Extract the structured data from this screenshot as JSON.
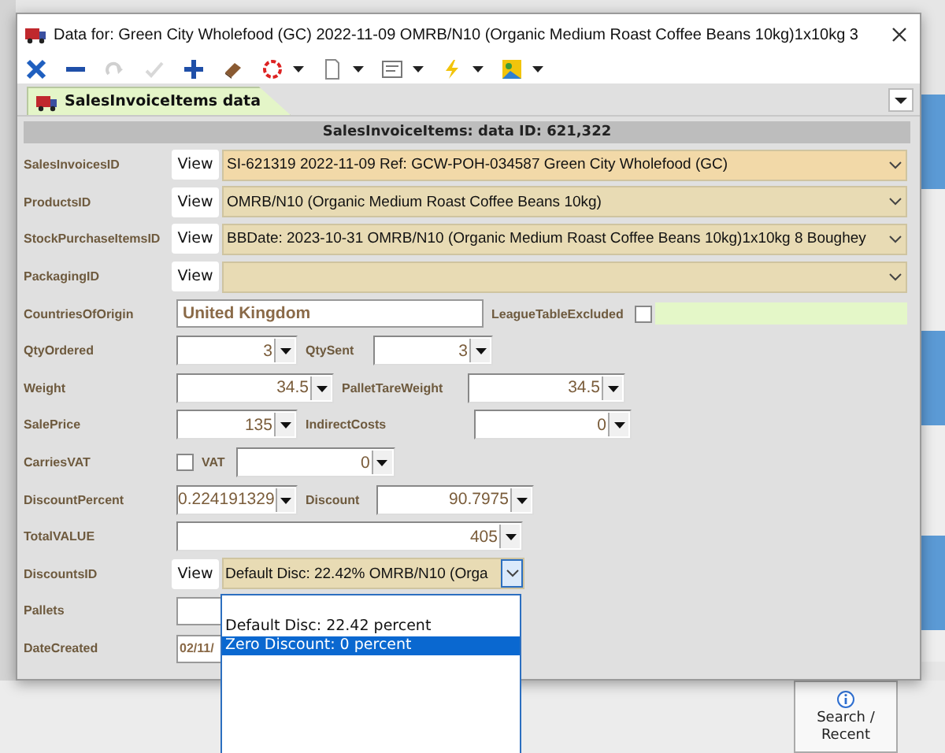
{
  "window": {
    "title": "Data for: Green City Wholefood (GC) 2022-11-09 OMRB/N10 (Organic Medium Roast Coffee Beans 10kg)1x10kg 3"
  },
  "toolbar": [
    {
      "kind": "cancel",
      "disabled": false,
      "menu": false
    },
    {
      "kind": "remove",
      "disabled": false,
      "menu": false
    },
    {
      "kind": "redo",
      "disabled": true,
      "menu": false
    },
    {
      "kind": "confirm",
      "disabled": true,
      "menu": false
    },
    {
      "kind": "add",
      "disabled": false,
      "menu": false
    },
    {
      "kind": "eraser",
      "disabled": false,
      "menu": false
    },
    {
      "kind": "undo",
      "disabled": false,
      "menu": true
    },
    {
      "kind": "document",
      "disabled": false,
      "menu": true
    },
    {
      "kind": "form",
      "disabled": false,
      "menu": true
    },
    {
      "kind": "lightning",
      "disabled": false,
      "menu": true
    },
    {
      "kind": "picture",
      "disabled": false,
      "menu": true
    }
  ],
  "tabs": [
    {
      "label": "SalesInvoiceItems data",
      "selected": true
    }
  ],
  "panel": {
    "header": "SalesInvoiceItems: data ID: 621,322",
    "rows": [
      {
        "items": [
          {
            "kind": "label",
            "text": "SalesInvoicesID"
          },
          {
            "kind": "view",
            "text": "View"
          },
          {
            "kind": "combo",
            "value": "SI-621319 2022-11-09 Ref: GCW-POH-034587 Green City Wholefood (GC)",
            "open": false
          }
        ]
      },
      {
        "items": [
          {
            "kind": "label",
            "text": "ProductsID"
          },
          {
            "kind": "view",
            "text": "View"
          },
          {
            "kind": "combo",
            "value": "OMRB/N10 (Organic Medium Roast Coffee Beans 10kg)",
            "open": false
          }
        ]
      },
      {
        "items": [
          {
            "kind": "label",
            "text": "StockPurchaseItemsID"
          },
          {
            "kind": "view",
            "text": "View"
          },
          {
            "kind": "combo",
            "value": "BBDate: 2023-10-31 OMRB/N10 (Organic Medium Roast Coffee Beans 10kg)1x10kg 8 Boughey",
            "open": false
          }
        ]
      },
      {
        "items": [
          {
            "kind": "label",
            "text": "PackagingID"
          },
          {
            "kind": "view",
            "text": "View"
          },
          {
            "kind": "combo",
            "open": false
          }
        ]
      },
      {
        "items": [
          {
            "kind": "label",
            "text": "CountriesOfOrigin"
          },
          {
            "kind": "text",
            "value": "United Kingdom"
          },
          {
            "kind": "label",
            "text": "LeagueTableExcluded"
          },
          {
            "kind": "checkbox",
            "checked": false
          },
          {
            "kind": "band"
          }
        ]
      },
      {
        "items": [
          {
            "kind": "label",
            "text": "QtyOrdered"
          },
          {
            "kind": "number",
            "value": "3"
          },
          {
            "kind": "label",
            "text": "QtySent"
          },
          {
            "kind": "number",
            "value": "3"
          }
        ]
      },
      {
        "items": [
          {
            "kind": "label",
            "text": "Weight"
          },
          {
            "kind": "number",
            "value": "34.5"
          },
          {
            "kind": "label",
            "text": "PalletTareWeight"
          },
          {
            "kind": "number",
            "value": "34.5"
          }
        ]
      },
      {
        "items": [
          {
            "kind": "label",
            "text": "SalePrice"
          },
          {
            "kind": "number",
            "value": "135"
          },
          {
            "kind": "label",
            "text": "IndirectCosts"
          },
          {
            "kind": "number",
            "value": "0"
          }
        ]
      },
      {
        "items": [
          {
            "kind": "label",
            "text": "CarriesVAT"
          },
          {
            "kind": "checkbox",
            "checked": false
          },
          {
            "kind": "label",
            "text": "VAT"
          },
          {
            "kind": "number",
            "value": "0"
          }
        ]
      },
      {
        "items": [
          {
            "kind": "label",
            "text": "DiscountPercent"
          },
          {
            "kind": "number",
            "value": "0.224191329"
          },
          {
            "kind": "label",
            "text": "Discount"
          },
          {
            "kind": "number",
            "value": "90.7975"
          }
        ]
      },
      {
        "items": [
          {
            "kind": "label",
            "text": "TotalVALUE"
          },
          {
            "kind": "number",
            "value": "405"
          }
        ]
      },
      {
        "items": [
          {
            "kind": "label",
            "text": "DiscountsID"
          },
          {
            "kind": "view",
            "text": "View"
          },
          {
            "kind": "combo",
            "value": "Default Disc: 22.42% OMRB/N10 (Orga",
            "open": true
          }
        ]
      },
      {
        "items": [
          {
            "kind": "label",
            "text": "Pallets"
          },
          {
            "kind": "text"
          }
        ]
      },
      {
        "items": [
          {
            "kind": "label",
            "text": "DateCreated"
          },
          {
            "kind": "text",
            "value": "02/11/"
          }
        ]
      }
    ]
  },
  "dropdown": {
    "items": [
      {
        "label": "Default Disc: 22.42 percent",
        "selected": false
      },
      {
        "label": "Zero Discount: 0 percent",
        "selected": true
      }
    ]
  },
  "background": {
    "buttons": [
      {
        "label": "Search / Recent"
      }
    ]
  }
}
